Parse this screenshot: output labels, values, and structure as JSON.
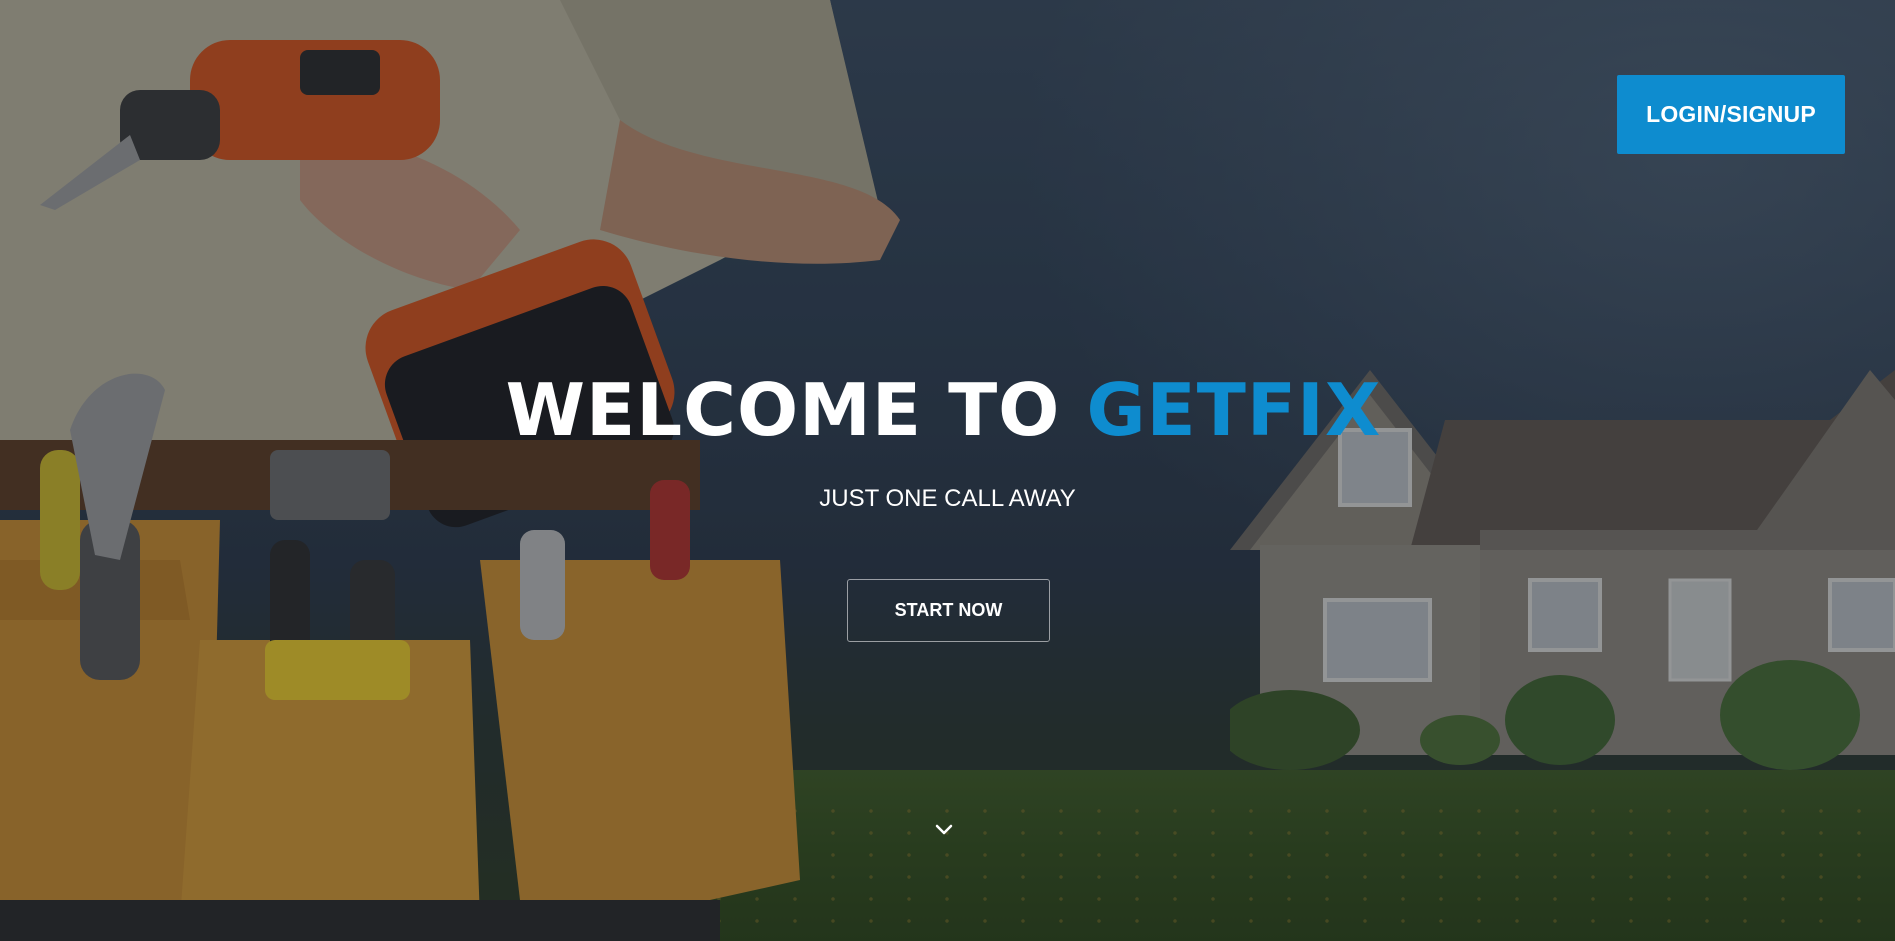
{
  "hero": {
    "title_main": "WELCOME TO ",
    "title_accent": "GETFIX",
    "subtitle": "JUST ONE CALL AWAY",
    "start_label": "START NOW"
  },
  "header": {
    "login_label": "LOGIN/SIGNUP"
  },
  "colors": {
    "accent": "#0e8ccf",
    "text": "#ffffff"
  },
  "icons": {
    "scroll": "chevron-down-icon"
  },
  "background": {
    "image": "handyman-with-drill-and-tool-belt-in-front-of-house"
  }
}
